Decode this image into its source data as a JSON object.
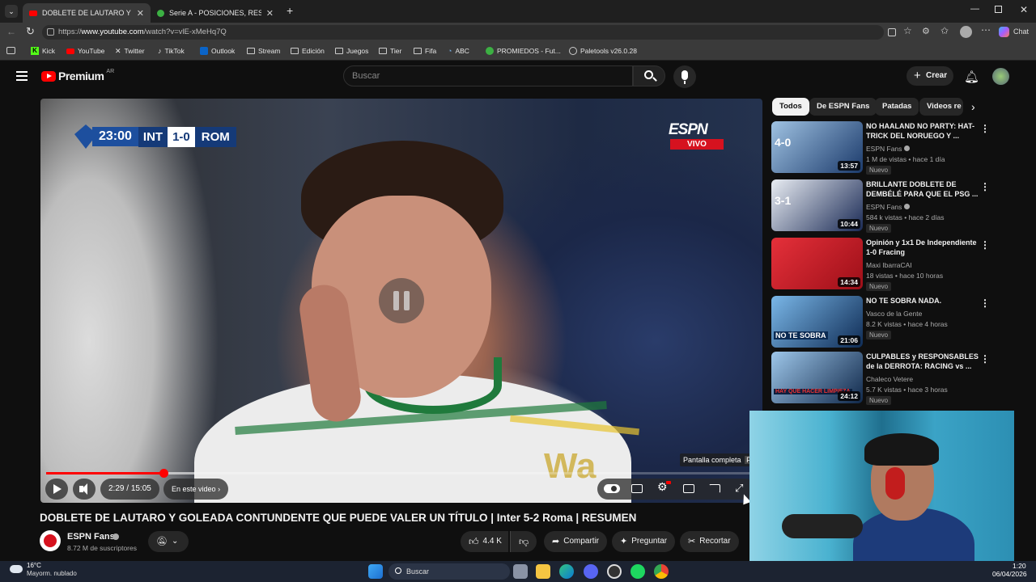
{
  "browser": {
    "tabs": [
      {
        "title": "DOBLETE DE LAUTARO Y GOLEA",
        "active": true
      },
      {
        "title": "Serie A - POSICIONES, RESULTADOS",
        "active": false
      }
    ],
    "url_prefix": "https://",
    "url_host": "www.youtube.com",
    "url_path": "/watch?v=vlE-xMeHq7Q",
    "chat_label": "Chat",
    "bookmarks": [
      "Kick",
      "YouTube",
      "Twitter",
      "TikTok",
      "Outlook",
      "Stream",
      "Edición",
      "Juegos",
      "Tier",
      "Fifa",
      "ABC",
      "PROMIEDOS - Fut...",
      "Paletools v26.0.28"
    ]
  },
  "youtube": {
    "logo_text": "Premium",
    "region": "AR",
    "search_placeholder": "Buscar",
    "create_label": "Crear"
  },
  "video": {
    "score_time": "23:00",
    "home": "INT",
    "score": "1-0",
    "away": "ROM",
    "broadcaster": "ESPN",
    "live_label": "VIVO",
    "progress_fraction": 0.165,
    "buffer_fraction": 0.21,
    "time_current": "2:29",
    "time_separator": " / ",
    "time_total": "15:05",
    "chapters_label": "En este video",
    "fullscreen_tooltip": "Pantalla completa",
    "fullscreen_key": "F",
    "watermark": "Wa"
  },
  "meta": {
    "title": "DOBLETE DE LAUTARO Y GOLEADA CONTUNDENTE QUE PUEDE VALER UN TÍTULO | Inter 5-2 Roma | RESUMEN",
    "channel": "ESPN Fans",
    "subscribers": "8.72 M de suscriptores",
    "likes": "4.4 K",
    "share_label": "Compartir",
    "ask_label": "Preguntar",
    "clip_label": "Recortar"
  },
  "chips": [
    "Todos",
    "De ESPN Fans",
    "Patadas",
    "Videos re"
  ],
  "recommendations": [
    {
      "title": "NO HAALAND NO PARTY: HAT-TRICK DEL NORUEGO Y ...",
      "channel": "ESPN Fans",
      "verified": true,
      "meta": "1 M de vistas • hace 1 día",
      "badge": "Nuevo",
      "duration": "13:57",
      "thumb_colors": [
        "#9fc2e2",
        "#1b3a6b"
      ],
      "thumb_text": "4-0"
    },
    {
      "title": "BRILLANTE DOBLETE DE DEMBÉLÉ PARA QUE EL PSG ...",
      "channel": "ESPN Fans",
      "verified": true,
      "meta": "584 k vistas • hace 2 días",
      "badge": "Nuevo",
      "duration": "10:44",
      "thumb_colors": [
        "#e9edf3",
        "#1a2a55"
      ],
      "thumb_text": "3-1"
    },
    {
      "title": "Opinión y 1x1 De Independiente 1-0 Fracing",
      "channel": "Maxi IbarraCAI",
      "verified": false,
      "meta": "18 vistas • hace 10 horas",
      "badge": "Nuevo",
      "duration": "14:34",
      "thumb_colors": [
        "#e5303a",
        "#9d0f18"
      ],
      "thumb_text": ""
    },
    {
      "title": "NO TE SOBRA NADA.",
      "channel": "Vasco de la Gente",
      "verified": false,
      "meta": "8.2 K vistas • hace 4 horas",
      "badge": "Nuevo",
      "duration": "21:06",
      "thumb_colors": [
        "#7ab7e8",
        "#0f2c55"
      ],
      "thumb_text": "NO TE SOBRA"
    },
    {
      "title": "CULPABLES y RESPONSABLES de la DERROTA: RACING vs ...",
      "channel": "Chaleco Vetere",
      "verified": false,
      "meta": "5.7 K vistas • hace 3 horas",
      "badge": "Nuevo",
      "duration": "24:12",
      "thumb_colors": [
        "#9ec7ea",
        "#10284a"
      ],
      "thumb_text": "HAY QUE HACER LIMPIEZA"
    }
  ],
  "taskbar": {
    "weather_temp": "16°C",
    "weather_desc": "Mayorm. nublado",
    "search_label": "Buscar",
    "time": "1:20",
    "date": "06/04/2026"
  },
  "colors": {
    "accent": "#ff0000",
    "espn_red": "#d6121f",
    "inter_blue": "#1d4f9e"
  }
}
